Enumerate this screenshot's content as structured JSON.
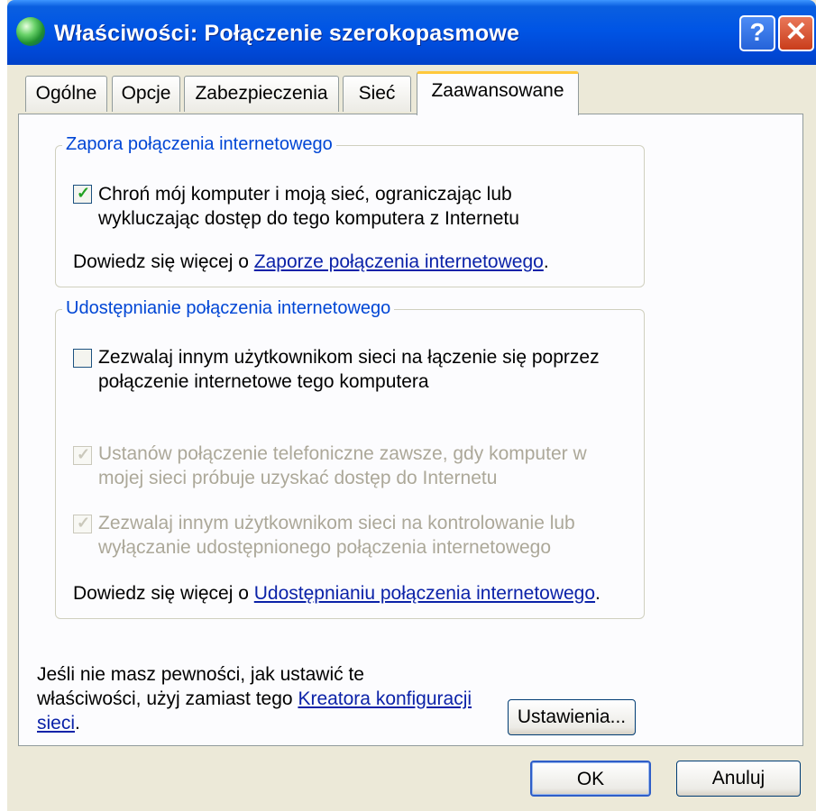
{
  "window": {
    "title": "Właściwości: Połączenie szerokopasmowe"
  },
  "titlebar": {
    "help_label": "?",
    "close_label": "✕"
  },
  "tabs": [
    {
      "label": "Ogólne"
    },
    {
      "label": "Opcje"
    },
    {
      "label": "Zabezpieczenia"
    },
    {
      "label": "Sieć"
    },
    {
      "label": "Zaawansowane",
      "active": true
    }
  ],
  "firewall": {
    "legend": "Zapora połączenia internetowego",
    "checkbox_checked": true,
    "checkbox_line1": "Chroń mój komputer i moją sieć, ograniczając lub",
    "checkbox_line2": "wykluczając dostęp do tego komputera z Internetu",
    "learn_prefix": "Dowiedz się więcej o ",
    "learn_link": "Zaporze połączenia internetowego",
    "learn_suffix": "."
  },
  "sharing": {
    "legend": "Udostępnianie połączenia internetowego",
    "allow_checked": false,
    "allow_line1": "Zezwalaj innym użytkownikom sieci na łączenie się poprzez",
    "allow_line2": "połączenie internetowe tego komputera",
    "dial_checked": true,
    "dial_line1": "Ustanów połączenie telefoniczne zawsze, gdy komputer w",
    "dial_line2": "mojej sieci próbuje uzyskać dostęp do Internetu",
    "control_checked": true,
    "control_line1": "Zezwalaj innym użytkownikom sieci na kontrolowanie lub",
    "control_line2": "wyłączanie udostępnionego połączenia internetowego",
    "learn_prefix": "Dowiedz się więcej o ",
    "learn_link": "Udostępnianiu połączenia internetowego",
    "learn_suffix": "."
  },
  "wizard": {
    "line1": "Jeśli nie masz pewności, jak ustawić te",
    "line2_prefix": "właściwości, użyj zamiast tego ",
    "link_part1": "Kreatora konfiguracji",
    "link_part2": "sieci",
    "suffix": "."
  },
  "buttons": {
    "settings": "Ustawienia...",
    "ok": "OK",
    "cancel": "Anuluj"
  },
  "colors": {
    "titlebar": "#0055e5",
    "dialog_bg": "#ece9d8",
    "group_label": "#0046d5",
    "check_mark": "#21a121"
  }
}
